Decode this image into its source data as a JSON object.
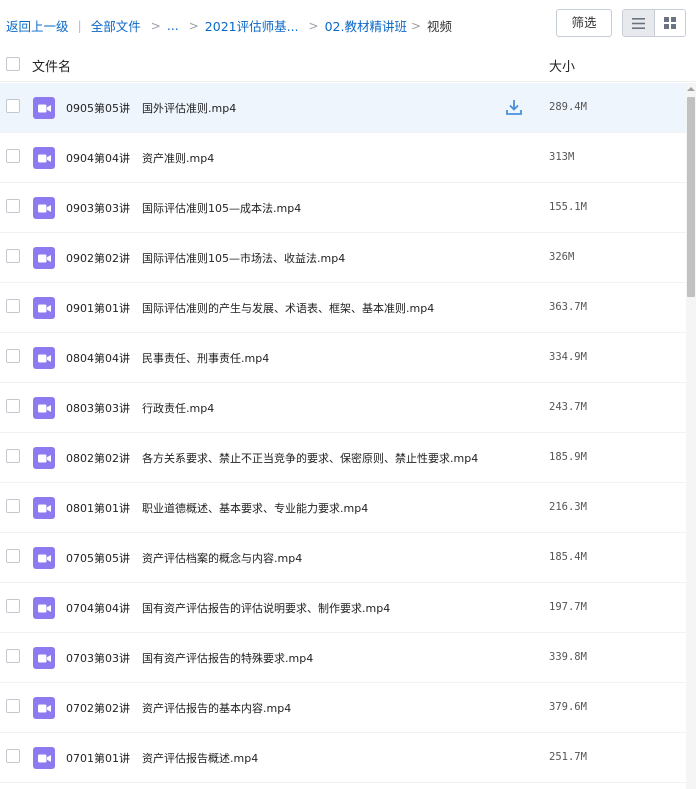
{
  "breadcrumb": {
    "back": "返回上一级",
    "separator": "|",
    "all_files": "全部文件",
    "ellipsis": "...",
    "level1": "2021评估师基...",
    "level2": "02.教材精讲班",
    "current": "视频",
    "arrow": ">"
  },
  "toolbar": {
    "filter_label": "筛选",
    "list_view_icon": "list-view-icon",
    "grid_view_icon": "grid-view-icon"
  },
  "table": {
    "col_name": "文件名",
    "col_size": "大小"
  },
  "colors": {
    "link": "#0a68c7",
    "video_icon": "#8d7af0",
    "hover_row": "#eef5fd",
    "download": "#4a90d9"
  },
  "files": [
    {
      "num": "0905第05讲",
      "title": "国外评估准则.mp4",
      "size": "289.4M",
      "hover": true
    },
    {
      "num": "0904第04讲",
      "title": "资产准则.mp4",
      "size": "313M"
    },
    {
      "num": "0903第03讲",
      "title": "国际评估准则105—成本法.mp4",
      "size": "155.1M"
    },
    {
      "num": "0902第02讲",
      "title": "国际评估准则105—市场法、收益法.mp4",
      "size": "326M"
    },
    {
      "num": "0901第01讲",
      "title": "国际评估准则的产生与发展、术语表、框架、基本准则.mp4",
      "size": "363.7M"
    },
    {
      "num": "0804第04讲",
      "title": "民事责任、刑事责任.mp4",
      "size": "334.9M"
    },
    {
      "num": "0803第03讲",
      "title": "行政责任.mp4",
      "size": "243.7M"
    },
    {
      "num": "0802第02讲",
      "title": "各方关系要求、禁止不正当竞争的要求、保密原则、禁止性要求.mp4",
      "size": "185.9M"
    },
    {
      "num": "0801第01讲",
      "title": "职业道德概述、基本要求、专业能力要求.mp4",
      "size": "216.3M"
    },
    {
      "num": "0705第05讲",
      "title": "资产评估档案的概念与内容.mp4",
      "size": "185.4M"
    },
    {
      "num": "0704第04讲",
      "title": "国有资产评估报告的评估说明要求、制作要求.mp4",
      "size": "197.7M"
    },
    {
      "num": "0703第03讲",
      "title": "国有资产评估报告的特殊要求.mp4",
      "size": "339.8M"
    },
    {
      "num": "0702第02讲",
      "title": "资产评估报告的基本内容.mp4",
      "size": "379.6M"
    },
    {
      "num": "0701第01讲",
      "title": "资产评估报告概述.mp4",
      "size": "251.7M"
    }
  ]
}
